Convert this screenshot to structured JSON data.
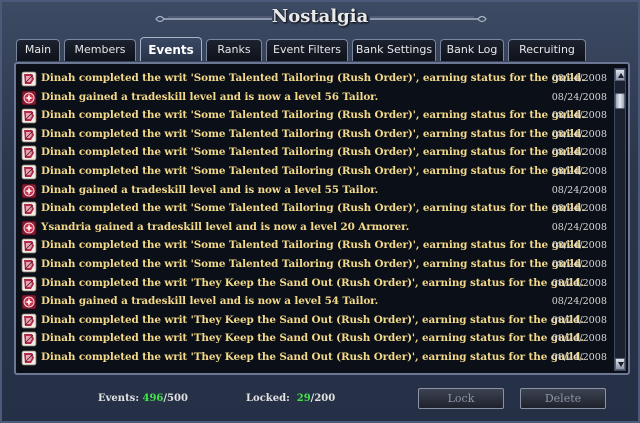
{
  "window": {
    "title": "Nostalgia"
  },
  "tabs": [
    {
      "label": "Main",
      "active": false
    },
    {
      "label": "Members",
      "active": false
    },
    {
      "label": "Events",
      "active": true
    },
    {
      "label": "Ranks",
      "active": false
    },
    {
      "label": "Event Filters",
      "active": false
    },
    {
      "label": "Bank Settings",
      "active": false
    },
    {
      "label": "Bank Log",
      "active": false
    },
    {
      "label": "Recruiting",
      "active": false
    }
  ],
  "events": [
    {
      "icon": "scroll-icon",
      "text": "Dinah completed the writ 'Some Talented Tailoring (Rush Order)', earning status for the guild.",
      "date": "08/24/2008"
    },
    {
      "icon": "tradeskill-icon",
      "text": "Dinah gained a tradeskill level and is now a level 56 Tailor.",
      "date": "08/24/2008"
    },
    {
      "icon": "scroll-icon",
      "text": "Dinah completed the writ 'Some Talented Tailoring (Rush Order)', earning status for the guild.",
      "date": "08/24/2008"
    },
    {
      "icon": "scroll-icon",
      "text": "Dinah completed the writ 'Some Talented Tailoring (Rush Order)', earning status for the guild.",
      "date": "08/24/2008"
    },
    {
      "icon": "scroll-icon",
      "text": "Dinah completed the writ 'Some Talented Tailoring (Rush Order)', earning status for the guild.",
      "date": "08/24/2008"
    },
    {
      "icon": "scroll-icon",
      "text": "Dinah completed the writ 'Some Talented Tailoring (Rush Order)', earning status for the guild.",
      "date": "08/24/2008"
    },
    {
      "icon": "tradeskill-icon",
      "text": "Dinah gained a tradeskill level and is now a level 55 Tailor.",
      "date": "08/24/2008"
    },
    {
      "icon": "scroll-icon",
      "text": "Dinah completed the writ 'Some Talented Tailoring (Rush Order)', earning status for the guild.",
      "date": "08/24/2008"
    },
    {
      "icon": "tradeskill-icon",
      "text": "Ysandria gained a tradeskill level and is now a level 20 Armorer.",
      "date": "08/24/2008"
    },
    {
      "icon": "scroll-icon",
      "text": "Dinah completed the writ 'Some Talented Tailoring (Rush Order)', earning status for the guild.",
      "date": "08/24/2008"
    },
    {
      "icon": "scroll-icon",
      "text": "Dinah completed the writ 'Some Talented Tailoring (Rush Order)', earning status for the guild.",
      "date": "08/24/2008"
    },
    {
      "icon": "scroll-icon",
      "text": "Dinah completed the writ 'They Keep the Sand Out (Rush Order)', earning status for the guild.",
      "date": "08/24/2008"
    },
    {
      "icon": "tradeskill-icon",
      "text": "Dinah gained a tradeskill level and is now a level 54 Tailor.",
      "date": "08/24/2008"
    },
    {
      "icon": "scroll-icon",
      "text": "Dinah completed the writ 'They Keep the Sand Out (Rush Order)', earning status for the guild.",
      "date": "08/24/2008"
    },
    {
      "icon": "scroll-icon",
      "text": "Dinah completed the writ 'They Keep the Sand Out (Rush Order)', earning status for the guild.",
      "date": "08/24/2008"
    },
    {
      "icon": "scroll-icon",
      "text": "Dinah completed the writ 'They Keep the Sand Out (Rush Order)', earning status for the guild.",
      "date": "08/24/2008"
    }
  ],
  "footer": {
    "events_label": "Events:",
    "events_count": "496",
    "events_sep": "/",
    "events_max": "500",
    "locked_label": "Locked:",
    "locked_count": "29",
    "locked_sep": "/",
    "locked_max": "200",
    "lock_button": "Lock",
    "delete_button": "Delete"
  },
  "colors": {
    "event_text": "#f3d98a",
    "count_green": "#44e04a"
  }
}
